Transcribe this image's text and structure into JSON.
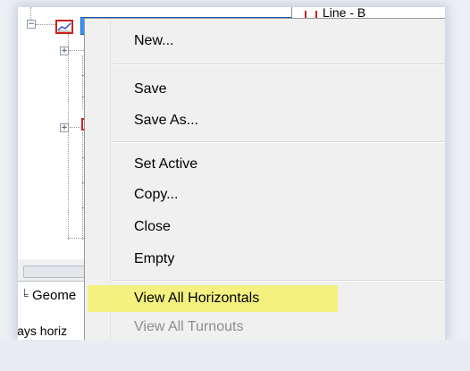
{
  "right_panel": {
    "line_label": "Line - B"
  },
  "tree": {
    "selected_item_label": ""
  },
  "tabs": {
    "geometry_label": "Geome"
  },
  "status": {
    "text": "lays horiz"
  },
  "menu": {
    "items": [
      {
        "label": "New...",
        "enabled": true
      },
      {
        "label": "Save",
        "enabled": true
      },
      {
        "label": "Save As...",
        "enabled": true
      },
      {
        "label": "Set Active",
        "enabled": true
      },
      {
        "label": "Copy...",
        "enabled": true
      },
      {
        "label": "Close",
        "enabled": true
      },
      {
        "label": "Empty",
        "enabled": true
      },
      {
        "label": "View All Horizontals",
        "enabled": true,
        "highlighted": true
      },
      {
        "label": "View All Turnouts",
        "enabled": false
      }
    ]
  },
  "colors": {
    "highlight": "#f3f07a",
    "selection": "#3399ff",
    "icon_red": "#cc2222"
  }
}
